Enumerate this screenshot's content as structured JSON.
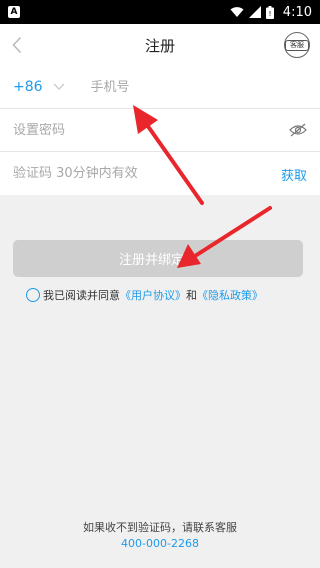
{
  "status_bar": {
    "app_badge": "A",
    "time": "4:10"
  },
  "header": {
    "title": "注册",
    "service_label": "客服"
  },
  "form": {
    "country_code": "+86",
    "phone_placeholder": "手机号",
    "password_placeholder": "设置密码",
    "code_placeholder": "验证码 30分钟内有效",
    "get_code_label": "获取"
  },
  "submit": {
    "label": "注册并绑定微"
  },
  "agreement": {
    "prefix": "我已阅读并同意",
    "user_agreement": "《用户协议》",
    "and": "和",
    "privacy_policy": "《隐私政策》"
  },
  "footer": {
    "note": "如果收不到验证码，请联系客服",
    "phone": "400-000-2268"
  },
  "colors": {
    "accent": "#1e9be8",
    "arrow": "#e8262b",
    "button_disabled": "#cfcfcf"
  },
  "icons": [
    "back-chevron-icon",
    "service-headset-icon",
    "chevron-down-icon",
    "eye-closed-icon",
    "wifi-icon",
    "signal-icon",
    "battery-icon"
  ]
}
